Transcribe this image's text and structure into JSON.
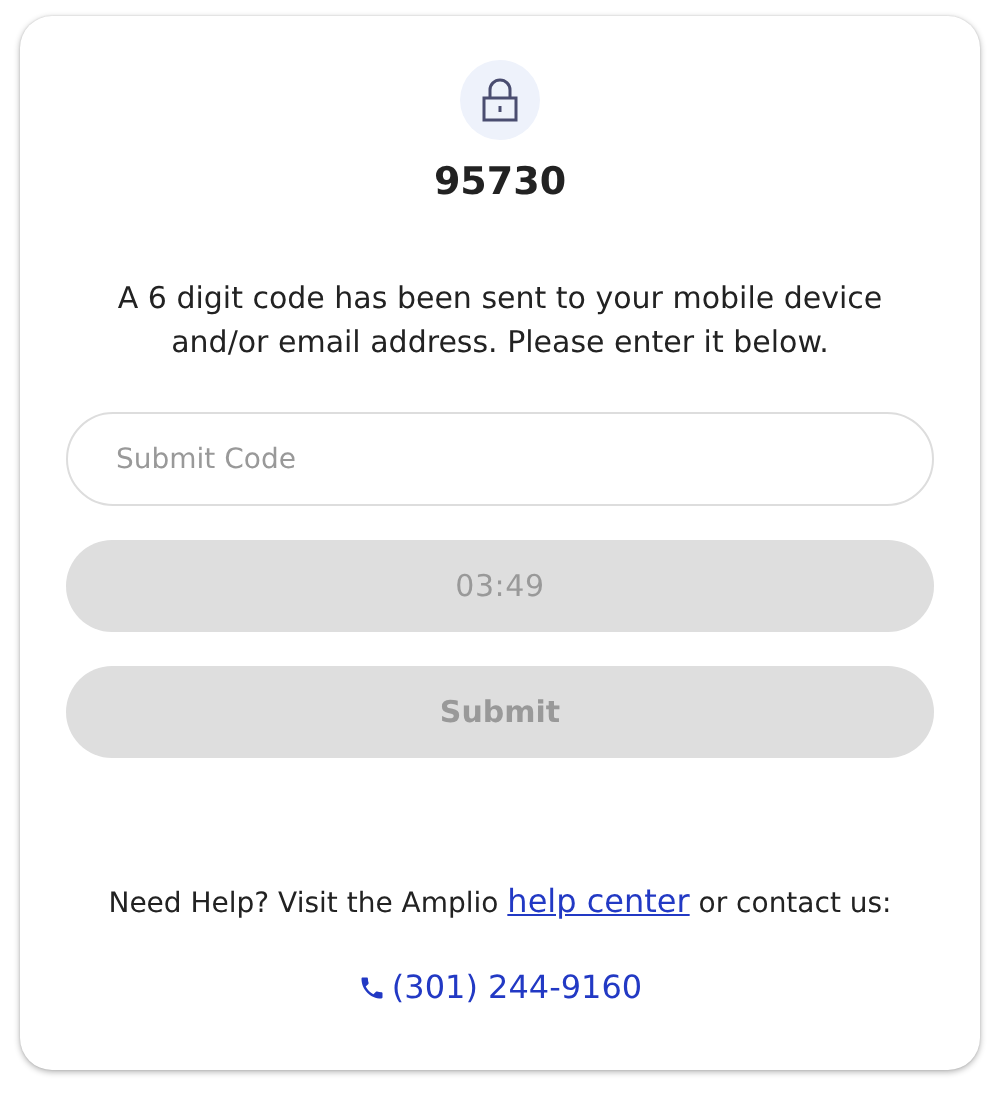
{
  "code_title": "95730",
  "message": "A 6 digit code has been sent to your mobile device and/or email address. Please enter it below.",
  "code_field": {
    "placeholder": "Submit Code"
  },
  "buttons": [
    {
      "kind": "timer",
      "label": "03:49",
      "disabled": true
    },
    {
      "kind": "submit",
      "label": "Submit",
      "disabled": true
    }
  ],
  "help": {
    "before": "Need Help? Visit the Amplio ",
    "link": "help center",
    "after": " or contact us:"
  },
  "phone": "(301) 244-9160"
}
